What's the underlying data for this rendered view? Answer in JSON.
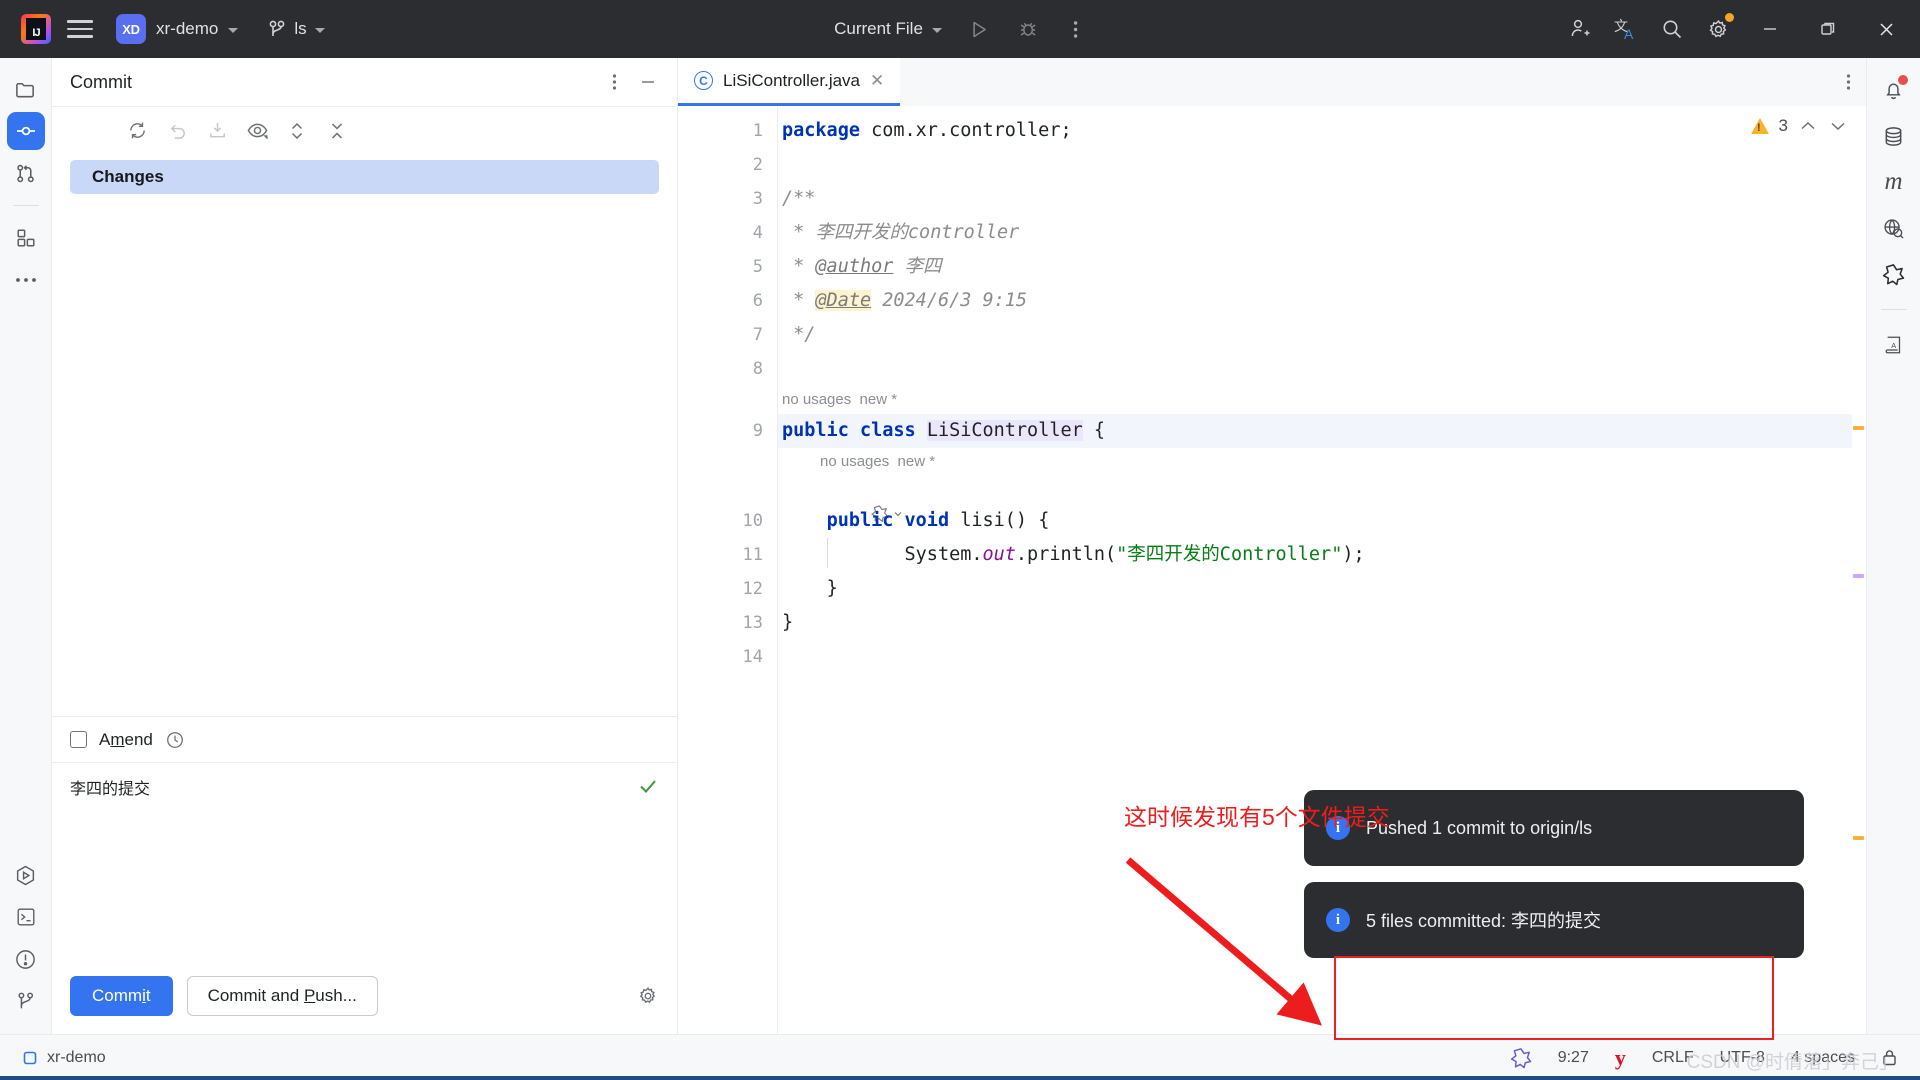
{
  "titlebar": {
    "menu_icon": "hamburger-icon",
    "project_badge": "XD",
    "project_name": "xr-demo",
    "branch_icon": "git-branch-icon",
    "branch_name": "ls",
    "run_config": "Current File",
    "run_icon": "run-icon",
    "debug_icon": "debug-icon",
    "more_icon": "more-vertical-icon",
    "account_icon": "add-user-icon",
    "translate_icon": "translate-icon",
    "search_icon": "search-icon",
    "settings_icon": "gear-icon",
    "minimize": "minimize-icon",
    "maximize": "maximize-icon",
    "close": "close-icon"
  },
  "left_stripe": {
    "items": [
      {
        "name": "project-tool-window",
        "icon": "folder-icon",
        "active": false
      },
      {
        "name": "commit-tool-window",
        "icon": "commit-icon",
        "active": true
      },
      {
        "name": "pull-requests-tool-window",
        "icon": "pull-request-icon",
        "active": false
      },
      {
        "name": "structure-tool-window",
        "icon": "grid-icon",
        "active": false
      },
      {
        "name": "more-tool-windows",
        "icon": "ellipsis-icon",
        "active": false
      }
    ],
    "bottom_items": [
      {
        "name": "run-tool-window",
        "icon": "run-hex-icon"
      },
      {
        "name": "terminal-tool-window",
        "icon": "terminal-icon"
      },
      {
        "name": "problems-tool-window",
        "icon": "warning-circle-icon"
      },
      {
        "name": "git-tool-window",
        "icon": "git-branch-icon"
      }
    ]
  },
  "commit_panel": {
    "title": "Commit",
    "header_actions": [
      {
        "name": "options-menu",
        "icon": "more-vertical-icon"
      },
      {
        "name": "hide-tool-window",
        "icon": "minimize-icon"
      }
    ],
    "toolbar": [
      {
        "name": "refresh-changes",
        "icon": "refresh-icon",
        "dim": false
      },
      {
        "name": "rollback",
        "icon": "undo-icon",
        "dim": true
      },
      {
        "name": "shelve-changes",
        "icon": "download-box-icon",
        "dim": true
      },
      {
        "name": "show-diff-preview",
        "icon": "eye-icon",
        "dim": false
      },
      {
        "name": "expand-collapse",
        "icon": "expand-collapse-icon",
        "dim": false
      },
      {
        "name": "collapse-all",
        "icon": "collapse-all-icon",
        "dim": false
      }
    ],
    "changes_node": "Changes",
    "amend_label_pre": "A",
    "amend_label_underline": "m",
    "amend_label_post": "end",
    "amend_checked": false,
    "history_icon": "clock-icon",
    "commit_message": "李四的提交",
    "message_ok_icon": "check-icon",
    "commit_button": {
      "pre": "Comm",
      "underline": "i",
      "post": "t"
    },
    "commit_push_button": {
      "pre": "Commit and ",
      "underline": "P",
      "post": "ush..."
    },
    "settings_icon": "gear-icon"
  },
  "editor": {
    "tab": {
      "label": "LiSiController.java",
      "file_icon": "java-class-icon",
      "close_icon": "close-icon"
    },
    "more_icon": "more-vertical-icon",
    "inspections": {
      "warning_icon": "warning-triangle-icon",
      "count": "3",
      "prev_icon": "chevron-up-icon",
      "next_icon": "chevron-down-icon"
    },
    "line_numbers": [
      "1",
      "2",
      "3",
      "4",
      "5",
      "6",
      "7",
      "8",
      "9",
      "10",
      "11",
      "12",
      "13",
      "14"
    ],
    "code": {
      "l1_kw": "package",
      "l1_rest": " com.xr.controller;",
      "l3": "/**",
      "l4_star": " * ",
      "l4_text": "李四开发的controller",
      "l5_star": " * ",
      "l5_tag": "@author",
      "l5_text": " 李四",
      "l6_star": " * ",
      "l6_tag": "@Date",
      "l6_text": " 2024/6/3 9:15",
      "l7": " */",
      "hint_class": "no usages  new *",
      "l9_kw1": "public",
      "l9_kw2": "class",
      "l9_name": "LiSiController",
      "l9_brace": "{",
      "hint_method": "no usages  new *",
      "gutter_method_icon": "spring-bean-icon",
      "l10_kw1": "public",
      "l10_kw2": "void",
      "l10_name": "lisi() {",
      "l11_sys": "System.",
      "l11_out": "out",
      "l11_println": ".println(",
      "l11_str": "\"李四开发的Controller\"",
      "l11_end": ");",
      "l12": "}",
      "l13": "}"
    }
  },
  "right_stripe": {
    "items": [
      {
        "name": "notifications-tool-window",
        "icon": "bell-icon",
        "badge": true
      },
      {
        "name": "database-tool-window",
        "icon": "database-icon",
        "badge": false
      },
      {
        "name": "maven-tool-window",
        "icon": "maven-m-icon",
        "badge": false
      },
      {
        "name": "endpoints-tool-window",
        "icon": "globe-search-icon",
        "badge": false
      },
      {
        "name": "spring-tool-window",
        "icon": "spring-leaf-icon",
        "badge": false
      },
      {
        "name": "translation-tool-window",
        "icon": "dictionary-icon",
        "badge": false
      }
    ]
  },
  "notifications": [
    {
      "icon": "info-icon",
      "text": "Pushed 1 commit to origin/ls",
      "highlighted": false
    },
    {
      "icon": "info-icon",
      "text": "5 files committed: 李四的提交",
      "highlighted": true
    }
  ],
  "annotation": {
    "text": "这时候发现有5个文件提交",
    "color": "#ee1d1d",
    "arrow": "red-arrow-pointing-down-left"
  },
  "statusbar": {
    "project_icon": "module-icon",
    "project_label": "xr-demo",
    "right_items": [
      {
        "name": "spring-icon",
        "label": ""
      },
      {
        "name": "clock-time",
        "label": "9:27"
      },
      {
        "name": "youdao-icon",
        "label": ""
      },
      {
        "name": "line-separator",
        "label": "CRLF"
      },
      {
        "name": "encoding",
        "label": "UTF-8"
      },
      {
        "name": "indent",
        "label": "4 spaces"
      },
      {
        "name": "read-only-toggle",
        "label": ""
      }
    ]
  },
  "watermark": "CSDN @时倩落」奔己」"
}
